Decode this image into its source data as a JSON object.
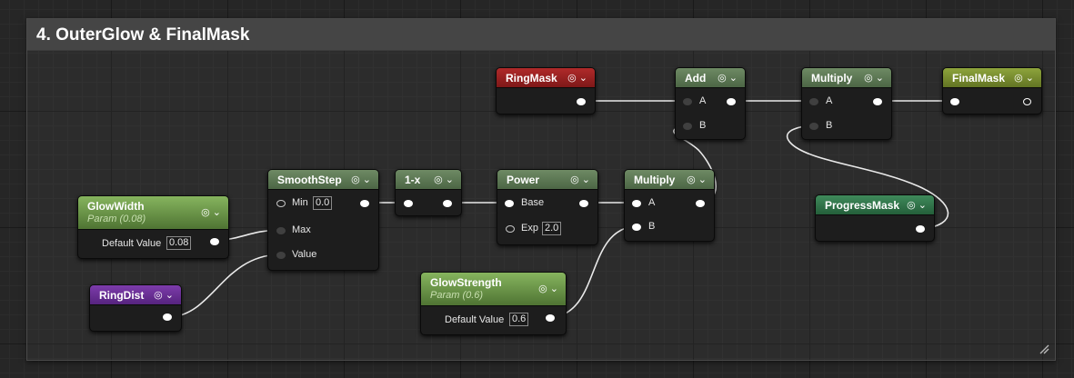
{
  "comment": {
    "title": "4. OuterGlow & FinalMask"
  },
  "nodes": {
    "ring_mask": {
      "title": "RingMask",
      "icons": "◎ ⌄"
    },
    "add": {
      "title": "Add",
      "icons": "◎ ⌄",
      "pin_a": "A",
      "pin_b": "B"
    },
    "multiply_top": {
      "title": "Multiply",
      "icons": "◎ ⌄",
      "pin_a": "A",
      "pin_b": "B"
    },
    "final_mask": {
      "title": "FinalMask",
      "icons": "◎ ⌄"
    },
    "smooth_step": {
      "title": "SmoothStep",
      "icons": "◎ ⌄",
      "pin_min": "Min",
      "min_value": "0.0",
      "pin_max": "Max",
      "pin_value": "Value"
    },
    "one_minus": {
      "title": "1-x",
      "icons": "◎ ⌄"
    },
    "power": {
      "title": "Power",
      "icons": "◎ ⌄",
      "pin_base": "Base",
      "pin_exp": "Exp",
      "exp_value": "2.0"
    },
    "multiply_mid": {
      "title": "Multiply",
      "icons": "◎ ⌄",
      "pin_a": "A",
      "pin_b": "B"
    },
    "progress_mask": {
      "title": "ProgressMask",
      "icons": "◎ ⌄"
    },
    "glow_width": {
      "title": "GlowWidth",
      "subtitle": "Param (0.08)",
      "icons": "◎ ⌄",
      "default_label": "Default Value",
      "default_value": "0.08"
    },
    "ring_dist": {
      "title": "RingDist",
      "icons": "◎ ⌄"
    },
    "glow_strength": {
      "title": "GlowStrength",
      "subtitle": "Param (0.6)",
      "icons": "◎ ⌄",
      "default_label": "Default Value",
      "default_value": "0.6"
    }
  },
  "colors": {
    "background": "#262626",
    "wire": "#ffffff",
    "header_generic": "#5e7a56",
    "header_ring_mask": "#9b2222",
    "header_final_mask": "#7a8e30",
    "header_progress_mask": "#307a4a",
    "header_ring_dist": "#6a2f96",
    "header_param": "#6e9a48"
  }
}
